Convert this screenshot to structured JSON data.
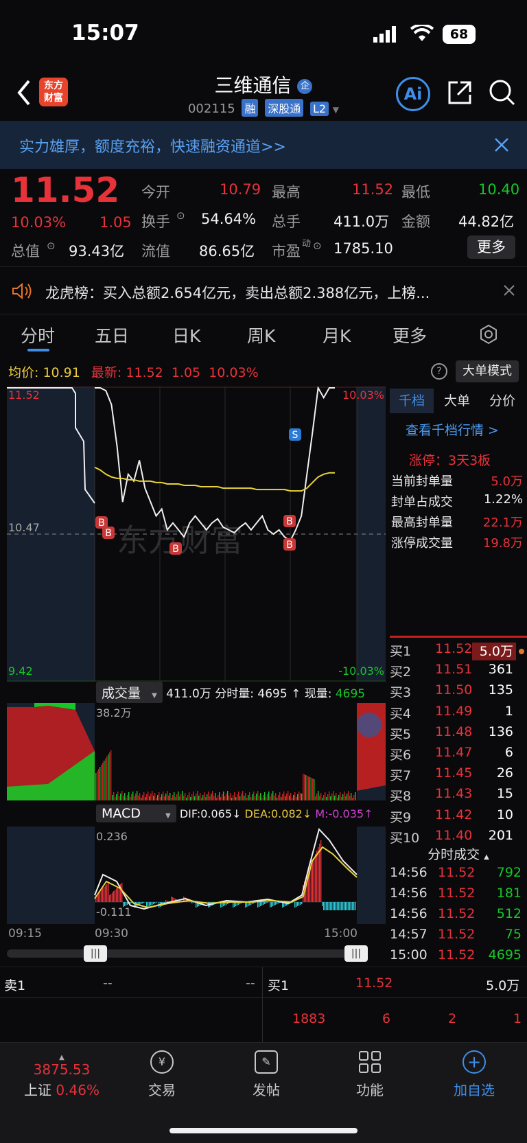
{
  "status_bar": {
    "time": "15:07",
    "battery": "68"
  },
  "header": {
    "logo_text_1": "东方",
    "logo_text_2": "财富",
    "title": "三维通信",
    "title_badge": "企",
    "code": "002115",
    "tags": [
      "融",
      "深股通",
      "L2"
    ],
    "ai_label": "Ai"
  },
  "banner": {
    "text": "实力雄厚，额度充裕，快速融资通道>>"
  },
  "quote": {
    "price": "11.52",
    "pct": "10.03%",
    "change": "1.05",
    "open_label": "今开",
    "open": "10.79",
    "high_label": "最高",
    "high": "11.52",
    "low_label": "最低",
    "low": "10.40",
    "turnover_label": "换手",
    "turnover": "54.64%",
    "volume_label": "总手",
    "volume": "411.0万",
    "amount_label": "金额",
    "amount": "44.82亿",
    "mktcap_label": "总值",
    "mktcap": "93.43亿",
    "float_label": "流值",
    "float": "86.65亿",
    "pe_label": "市盈",
    "pe_sup": "动",
    "pe": "1785.10",
    "more": "更多"
  },
  "notice": {
    "text": "龙虎榜：买入总额2.654亿元，卖出总额2.388亿元，上榜..."
  },
  "tabs": [
    "分时",
    "五日",
    "日K",
    "周K",
    "月K",
    "更多"
  ],
  "chart_info": {
    "avg_label": "均价:",
    "avg": "10.91",
    "latest_label": "最新:",
    "latest": "11.52",
    "latest_chg": "1.05",
    "latest_pct": "10.03%",
    "big_mode": "大单模式"
  },
  "chart_data": {
    "type": "line",
    "title": "",
    "y_top_label": "11.52",
    "y_mid_label": "10.47",
    "y_bot_label": "9.42",
    "pct_top_label": "10.03%",
    "pct_bot_label": "-10.03%",
    "ylim": [
      9.42,
      11.52
    ],
    "x_labels": [
      "09:15",
      "09:30",
      "15:00"
    ],
    "series": [
      {
        "values": [
          11.52,
          11.52,
          11.5,
          11.4,
          11.1,
          10.7,
          10.9,
          10.85,
          11.0,
          10.8,
          10.7,
          10.6,
          10.65,
          10.5,
          10.55,
          10.5,
          10.45,
          10.55,
          10.6,
          10.55,
          10.5,
          10.55,
          10.58,
          10.52,
          10.5,
          10.48,
          10.52,
          10.55,
          10.5,
          10.55,
          10.6,
          10.5,
          10.47,
          10.5,
          10.45,
          10.42,
          10.5,
          10.6,
          10.9,
          11.2,
          11.52,
          11.45,
          11.52,
          11.52
        ]
      },
      {
        "values": [
          10.95,
          10.93,
          10.9,
          10.88,
          10.87,
          10.87,
          10.86,
          10.86,
          10.85,
          10.85,
          10.85,
          10.84,
          10.84,
          10.83,
          10.83,
          10.83,
          10.82,
          10.82,
          10.82,
          10.81,
          10.81,
          10.81,
          10.81,
          10.8,
          10.8,
          10.8,
          10.8,
          10.8,
          10.8,
          10.79,
          10.79,
          10.79,
          10.79,
          10.79,
          10.79,
          10.78,
          10.78,
          10.78,
          10.8,
          10.84,
          10.88,
          10.9,
          10.91,
          10.91
        ]
      }
    ],
    "markers": [
      "B",
      "B",
      "B",
      "B",
      "B",
      "S"
    ],
    "watermark": "东方财富"
  },
  "volume": {
    "label": "成交量",
    "total": "411.0万",
    "tick_label": "分时量:",
    "tick": "4695",
    "now_label": "现量:",
    "now": "4695",
    "max": "38.2万"
  },
  "macd": {
    "label": "MACD",
    "dif": "DIF:0.065",
    "dea": "DEA:0.082",
    "m": "M:-0.035",
    "max": "0.236",
    "min": "-0.111"
  },
  "side_tabs": [
    "千档",
    "大单",
    "分价"
  ],
  "limit_panel": {
    "link": "查看千档行情 >",
    "streak": "涨停：3天3板",
    "rows": [
      {
        "label": "当前封单量",
        "value": "5.0万"
      },
      {
        "label": "封单占成交",
        "value": "1.22%"
      },
      {
        "label": "最高封单量",
        "value": "22.1万"
      },
      {
        "label": "涨停成交量",
        "value": "19.8万"
      }
    ]
  },
  "bids": [
    {
      "label": "买1",
      "price": "11.52",
      "vol": "5.0万"
    },
    {
      "label": "买2",
      "price": "11.51",
      "vol": "361"
    },
    {
      "label": "买3",
      "price": "11.50",
      "vol": "135"
    },
    {
      "label": "买4",
      "price": "11.49",
      "vol": "1"
    },
    {
      "label": "买5",
      "price": "11.48",
      "vol": "136"
    },
    {
      "label": "买6",
      "price": "11.47",
      "vol": "6"
    },
    {
      "label": "买7",
      "price": "11.45",
      "vol": "26"
    },
    {
      "label": "买8",
      "price": "11.43",
      "vol": "15"
    },
    {
      "label": "买9",
      "price": "11.42",
      "vol": "10"
    },
    {
      "label": "买10",
      "price": "11.40",
      "vol": "201"
    }
  ],
  "ticks_header": "分时成交",
  "ticks": [
    {
      "time": "14:56",
      "price": "11.52",
      "vol": "792"
    },
    {
      "time": "14:56",
      "price": "11.52",
      "vol": "181"
    },
    {
      "time": "14:56",
      "price": "11.52",
      "vol": "512"
    },
    {
      "time": "14:57",
      "price": "11.52",
      "vol": "75"
    },
    {
      "time": "15:00",
      "price": "11.52",
      "vol": "4695"
    }
  ],
  "level_bar": {
    "sell_label": "卖1",
    "sell_price": "--",
    "sell_vol": "--",
    "buy_label": "买1",
    "buy_price": "11.52",
    "buy_vol": "5.0万",
    "queue": [
      "1883",
      "6",
      "2",
      "1"
    ]
  },
  "bottom_nav": {
    "index_value": "3875.53",
    "index_name": "上证",
    "index_pct": "0.46%",
    "items": [
      "交易",
      "发帖",
      "功能",
      "加自选"
    ]
  }
}
